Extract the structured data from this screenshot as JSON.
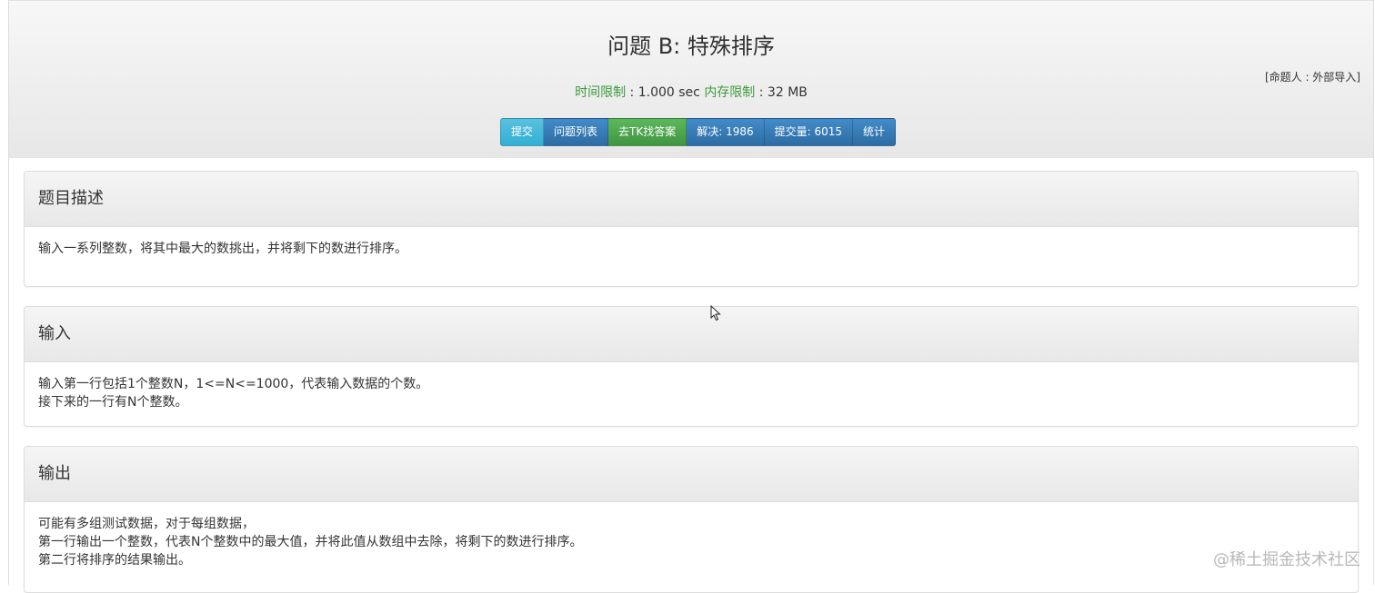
{
  "header": {
    "title": "问题 B: 特殊排序",
    "author": "[命题人 : 外部导入]",
    "time_limit_label": "时间限制",
    "time_limit_value": " : 1.000 sec ",
    "memory_limit_label": "内存限制",
    "memory_limit_value": " : 32 MB"
  },
  "toolbar": {
    "submit": "提交",
    "problem_list": "问题列表",
    "find_answer": "去TK找答案",
    "solved": "解决: 1986",
    "submissions": "提交量: 6015",
    "stats": "统计"
  },
  "sections": {
    "description": {
      "heading": "题目描述",
      "lines": [
        "输入一系列整数，将其中最大的数挑出，并将剩下的数进行排序。"
      ]
    },
    "input": {
      "heading": "输入",
      "lines": [
        "输入第一行包括1个整数N，1<=N<=1000，代表输入数据的个数。",
        "接下来的一行有N个整数。"
      ]
    },
    "output": {
      "heading": "输出",
      "lines": [
        "可能有多组测试数据，对于每组数据，",
        "第一行输出一个整数，代表N个整数中的最大值，并将此值从数组中去除，将剩下的数进行排序。",
        "第二行将排序的结果输出。"
      ]
    }
  },
  "watermark": "@稀土掘金技术社区",
  "colors": {
    "label_green": "#3c9a3c",
    "btn_info": "#5bc0de",
    "btn_primary": "#428bca",
    "btn_success": "#5cb85c"
  }
}
